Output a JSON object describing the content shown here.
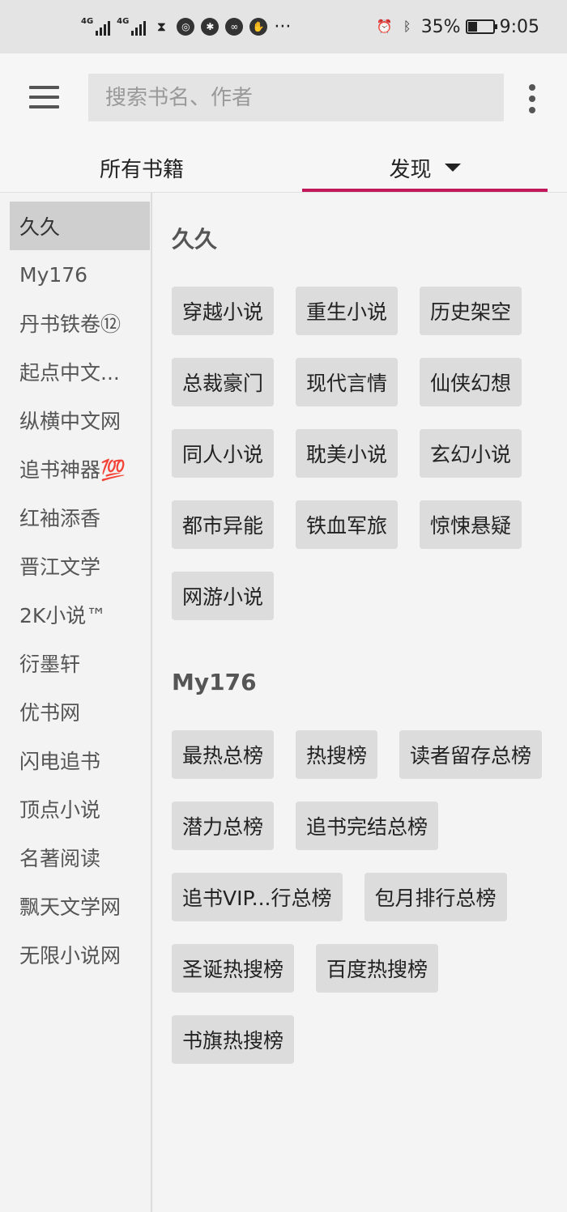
{
  "status_bar": {
    "net1": "4G",
    "net2": "4G",
    "more": "···",
    "battery_text": "35%",
    "battery_level": 0.35,
    "time": "9:05"
  },
  "search": {
    "placeholder": "搜索书名、作者"
  },
  "tabs": [
    {
      "label": "所有书籍"
    },
    {
      "label": "发现",
      "selected": true
    }
  ],
  "accent_color": "#c2185b",
  "sidebar": {
    "items": [
      "久久",
      "My176",
      "丹书铁卷⑫",
      "起点中文...",
      "纵横中文网",
      "追书神器💯",
      "红袖添香",
      "晋江文学",
      "2K小说™",
      "衍墨轩",
      "优书网",
      "闪电追书",
      "顶点小说",
      "名著阅读",
      "飘天文学网",
      "无限小说网"
    ],
    "selected_index": 0
  },
  "sections": [
    {
      "title": "久久",
      "chips": [
        "穿越小说",
        "重生小说",
        "历史架空",
        "总裁豪门",
        "现代言情",
        "仙侠幻想",
        "同人小说",
        "耽美小说",
        "玄幻小说",
        "都市异能",
        "铁血军旅",
        "惊悚悬疑",
        "网游小说"
      ]
    },
    {
      "title": "My176",
      "chips": [
        "最热总榜",
        "热搜榜",
        "读者留存总榜",
        "潜力总榜",
        "追书完结总榜",
        "追书VIP...行总榜",
        "包月排行总榜",
        "圣诞热搜榜",
        "百度热搜榜",
        "书旗热搜榜"
      ]
    }
  ]
}
